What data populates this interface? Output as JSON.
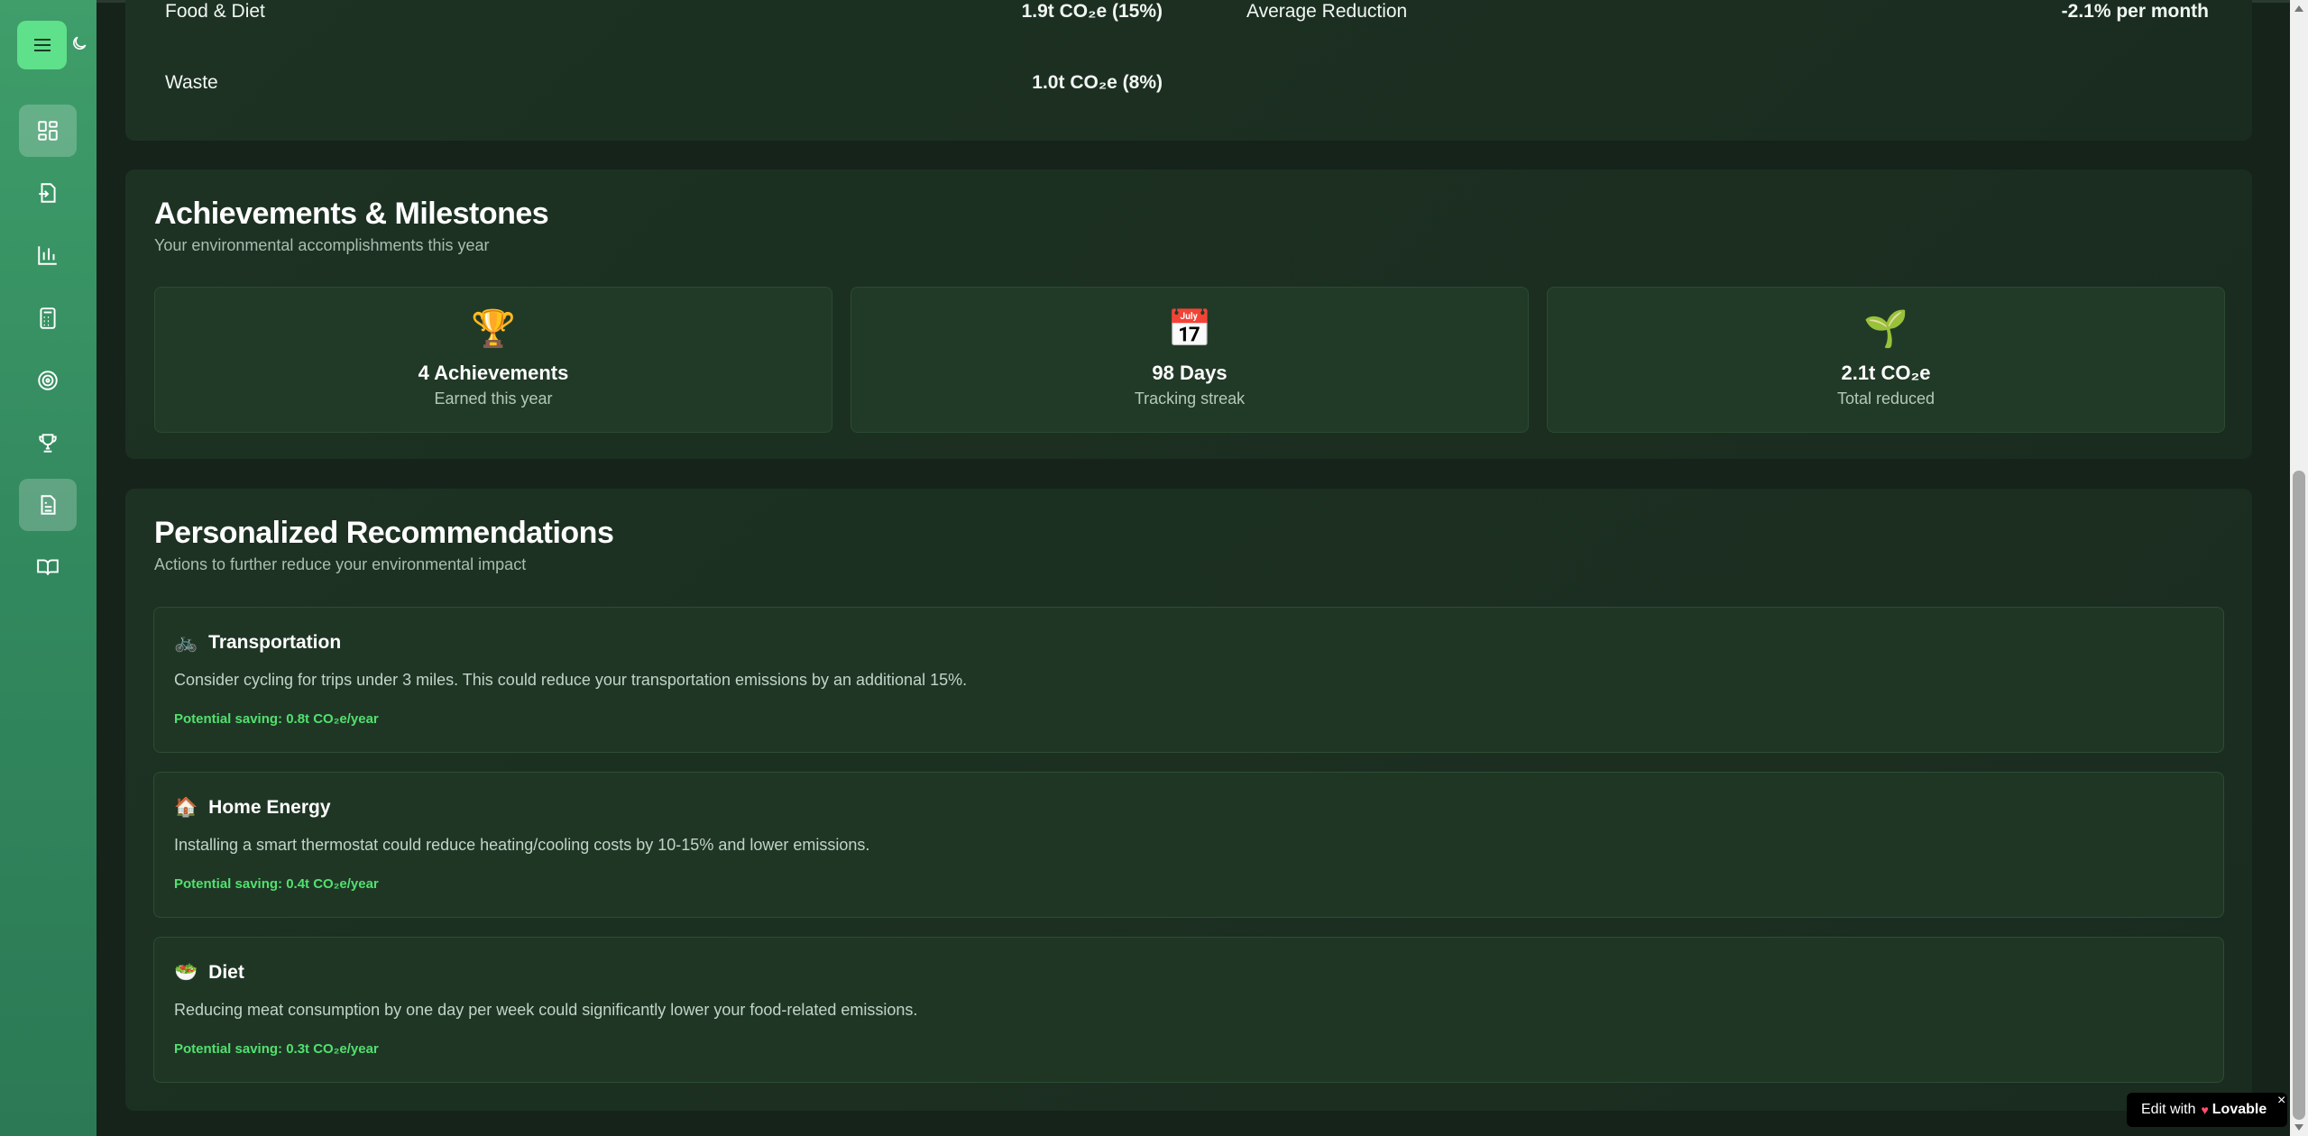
{
  "sidebar": {
    "nav": [
      {
        "icon": "dashboard-icon",
        "active": true
      },
      {
        "icon": "data-entry-icon",
        "active": false
      },
      {
        "icon": "analytics-icon",
        "active": false
      },
      {
        "icon": "calculator-icon",
        "active": false
      },
      {
        "icon": "target-icon",
        "active": false
      },
      {
        "icon": "trophy-icon",
        "active": false
      },
      {
        "icon": "report-icon",
        "active": true
      },
      {
        "icon": "book-icon",
        "active": false
      }
    ]
  },
  "breakdown": {
    "rows": [
      {
        "label": "Food & Diet",
        "value": "1.9t CO₂e (15%)"
      },
      {
        "label": "Waste",
        "value": "1.0t CO₂e (8%)"
      }
    ],
    "trend": {
      "label": "Average Reduction",
      "value": "-2.1% per month"
    }
  },
  "achievements": {
    "title": "Achievements & Milestones",
    "subtitle": "Your environmental accomplishments this year",
    "stats": [
      {
        "emoji": "🏆",
        "value": "4 Achievements",
        "label": "Earned this year"
      },
      {
        "emoji": "📅",
        "value": "98 Days",
        "label": "Tracking streak"
      },
      {
        "emoji": "🌱",
        "value": "2.1t CO₂e",
        "label": "Total reduced"
      }
    ]
  },
  "recommendations": {
    "title": "Personalized Recommendations",
    "subtitle": "Actions to further reduce your environmental impact",
    "items": [
      {
        "emoji": "🚲",
        "title": "Transportation",
        "description": "Consider cycling for trips under 3 miles. This could reduce your transportation emissions by an additional 15%.",
        "saving": "Potential saving: 0.8t CO₂e/year"
      },
      {
        "emoji": "🏠",
        "title": "Home Energy",
        "description": "Installing a smart thermostat could reduce heating/cooling costs by 10-15% and lower emissions.",
        "saving": "Potential saving: 0.4t CO₂e/year"
      },
      {
        "emoji": "🥗",
        "title": "Diet",
        "description": "Reducing meat consumption by one day per week could significantly lower your food-related emissions.",
        "saving": "Potential saving: 0.3t CO₂e/year"
      }
    ]
  },
  "badge": {
    "prefix": "Edit with",
    "brand": "Lovable",
    "close": "×"
  },
  "colors": {
    "accent": "#52e06e",
    "sidebar": "#3f9e6a",
    "background": "#15231b"
  }
}
